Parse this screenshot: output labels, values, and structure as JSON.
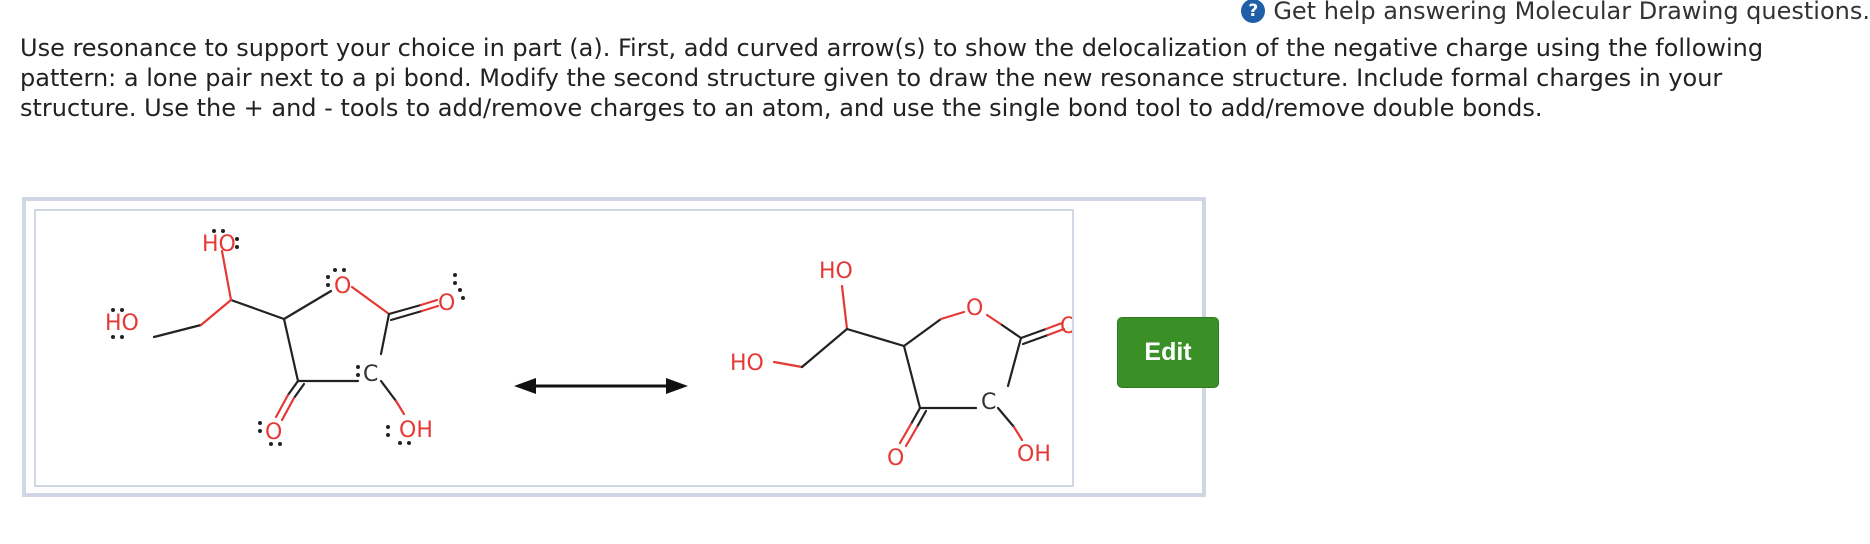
{
  "help": {
    "icon": "question-icon",
    "icon_glyph": "?",
    "label": "Get help answering Molecular Drawing questions."
  },
  "instructions": "Use resonance to support your choice in part (a). First, add curved arrow(s) to show the delocalization of the negative charge using the following pattern: a lone pair next to a pi bond. Modify the second structure given to draw the new resonance structure. Include formal charges in your structure. Use the + and - tools to add/remove charges to an atom, and use the single bond tool to add/remove double bonds.",
  "structure_left": {
    "labels": {
      "ho_top": "HO",
      "ho_left": "HO",
      "ring_o": "O",
      "carbonyl_o_right": "O",
      "carbonyl_o_bottom": "O",
      "carbanion_c": "C",
      "oh_bottom": "OH"
    }
  },
  "arrow": "resonance-double-arrow",
  "structure_right": {
    "labels": {
      "ho_top": "HO",
      "ho_left": "HO",
      "ring_o": "O",
      "carbonyl_o_right": "O",
      "carbonyl_o_bottom": "O",
      "carbanion_c": "C",
      "oh_bottom": "OH"
    }
  },
  "edit_button": "Edit",
  "colors": {
    "heteroatom": "#e53935",
    "edit_button_bg": "#3a8f26",
    "help_icon_bg": "#1f5fa8",
    "frame_border": "#cfd7e2"
  }
}
